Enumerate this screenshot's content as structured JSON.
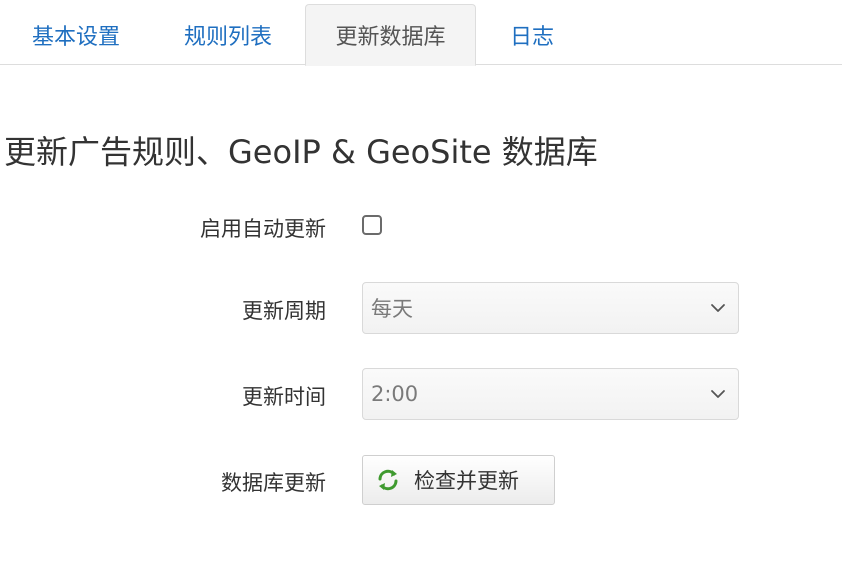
{
  "tabs": [
    {
      "label": "基本设置",
      "active": false
    },
    {
      "label": "规则列表",
      "active": false
    },
    {
      "label": "更新数据库",
      "active": true
    },
    {
      "label": "日志",
      "active": false
    }
  ],
  "section": {
    "title": "更新广告规则、GeoIP & GeoSite 数据库"
  },
  "form": {
    "auto_update": {
      "label": "启用自动更新",
      "checked": false
    },
    "update_period": {
      "label": "更新周期",
      "value": "每天"
    },
    "update_time": {
      "label": "更新时间",
      "value": "2:00"
    },
    "db_update": {
      "label": "数据库更新",
      "button_label": "检查并更新",
      "icon": "refresh-icon"
    }
  },
  "colors": {
    "tab_link": "#1f6fc0",
    "active_tab_bg": "#f4f4f4",
    "refresh_icon_green": "#3f9a2f"
  }
}
